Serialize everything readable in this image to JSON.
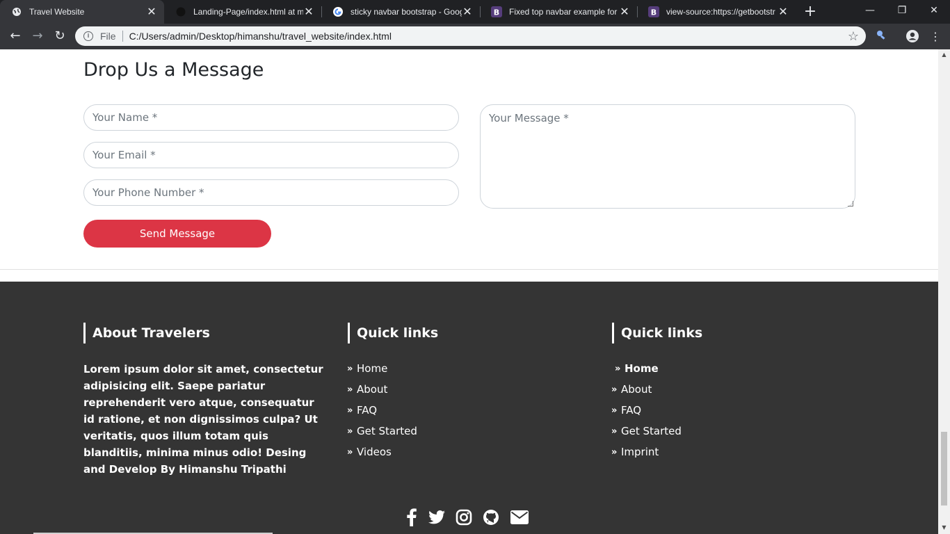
{
  "browser": {
    "tabs": [
      {
        "title": "Travel Website",
        "active": true,
        "icon": "globe-icon"
      },
      {
        "title": "Landing-Page/index.html at m",
        "active": false,
        "icon": "github-icon"
      },
      {
        "title": "sticky navbar bootstrap - Goog",
        "active": false,
        "icon": "google-icon"
      },
      {
        "title": "Fixed top navbar example for B",
        "active": false,
        "icon": "bootstrap-icon"
      },
      {
        "title": "view-source:https://getbootstr",
        "active": false,
        "icon": "bootstrap-icon"
      }
    ],
    "address": {
      "scheme_label": "File",
      "url": "C:/Users/admin/Desktop/himanshu/travel_website/index.html"
    }
  },
  "contact": {
    "heading": "Drop Us a Message",
    "name_placeholder": "Your Name *",
    "email_placeholder": "Your Email *",
    "phone_placeholder": "Your Phone Number *",
    "message_placeholder": "Your Message *",
    "send_label": "Send Message",
    "accent_color": "#dc3545"
  },
  "footer": {
    "about": {
      "title": "About Travelers",
      "text": "Lorem ipsum dolor sit amet, consectetur adipisicing elit. Saepe pariatur reprehenderit vero atque, consequatur id ratione, et non dignissimos culpa? Ut veritatis, quos illum totam quis blanditiis, minima minus odio! Desing and Develop By Himanshu Tripathi"
    },
    "links1": {
      "title": "Quick links",
      "items": [
        "Home",
        "About",
        "FAQ",
        "Get Started",
        "Videos"
      ]
    },
    "links2": {
      "title": "Quick links",
      "items": [
        "Home",
        "About",
        "FAQ",
        "Get Started",
        "Imprint"
      ]
    },
    "social": [
      "facebook-icon",
      "twitter-icon",
      "instagram-icon",
      "github-icon",
      "envelope-icon"
    ],
    "background": "#343434"
  }
}
